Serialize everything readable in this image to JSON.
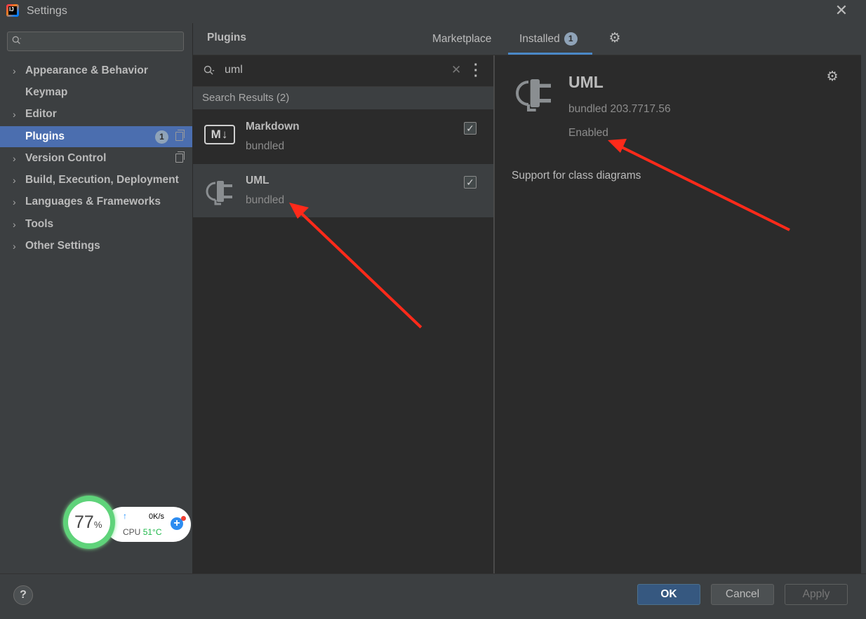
{
  "window": {
    "title": "Settings",
    "close_glyph": "✕"
  },
  "sidebar": {
    "search_placeholder": "",
    "items": [
      {
        "label": "Appearance & Behavior",
        "chevron": "›"
      },
      {
        "label": "Keymap",
        "chevron": ""
      },
      {
        "label": "Editor",
        "chevron": "›"
      },
      {
        "label": "Plugins",
        "chevron": "",
        "badge": "1",
        "selected": true
      },
      {
        "label": "Version Control",
        "chevron": "›"
      },
      {
        "label": "Build, Execution, Deployment",
        "chevron": "›"
      },
      {
        "label": "Languages & Frameworks",
        "chevron": "›"
      },
      {
        "label": "Tools",
        "chevron": "›"
      },
      {
        "label": "Other Settings",
        "chevron": "›"
      }
    ]
  },
  "header": {
    "title": "Plugins",
    "tabs": [
      {
        "label": "Marketplace"
      },
      {
        "label": "Installed",
        "badge": "1",
        "active": true
      }
    ]
  },
  "plugin_list": {
    "search_value": "uml",
    "results_header": "Search Results (2)",
    "items": [
      {
        "name": "Markdown",
        "version": "bundled",
        "icon_text": "M↓",
        "checked": true
      },
      {
        "name": "UML",
        "version": "bundled",
        "checked": true,
        "selected": true
      }
    ]
  },
  "detail": {
    "name": "UML",
    "version": "bundled 203.7717.56",
    "status": "Enabled",
    "description": "Support for class diagrams"
  },
  "widget": {
    "percent": "77",
    "percent_sign": "%",
    "arrow": "↑",
    "speed": "0K/s",
    "cpu_label": "CPU",
    "cpu_temp": "51°C"
  },
  "footer": {
    "help_label": "?",
    "ok_label": "OK",
    "cancel_label": "Cancel",
    "apply_label": "Apply"
  },
  "colors": {
    "selection": "#4b6eaf",
    "tab_underline": "#4a88c7",
    "ok_button": "#365880",
    "annotation_arrow": "#ff2a1a"
  }
}
